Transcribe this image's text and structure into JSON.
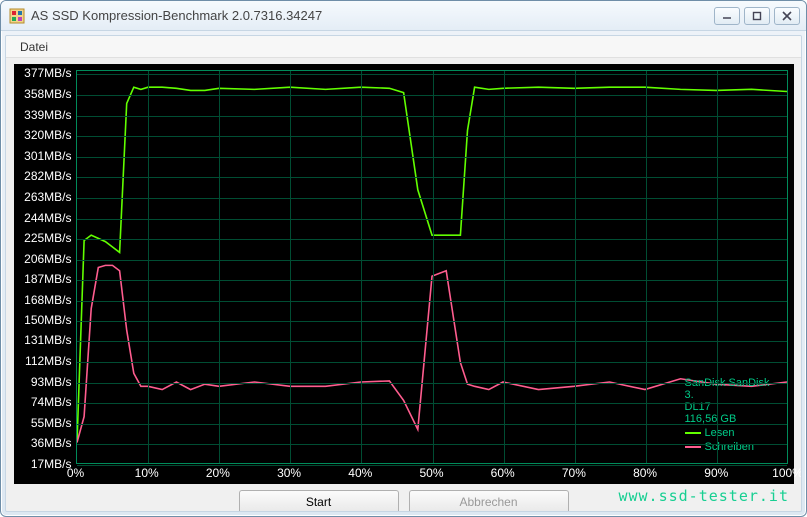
{
  "window": {
    "title": "AS SSD Kompression-Benchmark 2.0.7316.34247"
  },
  "menu": {
    "file": "Datei"
  },
  "buttons": {
    "start": "Start",
    "cancel": "Abbrechen"
  },
  "watermark": "www.ssd-tester.it",
  "legend": {
    "device_line1": "SanDisk SanDisk 3.",
    "device_line2": "DL17",
    "capacity": "116,56 GB",
    "read": "Lesen",
    "write": "Schreiben"
  },
  "colors": {
    "read_line": "#62ff00",
    "write_line": "#ff5d8f",
    "grid": "#004d33",
    "border": "#008b5a"
  },
  "chart_data": {
    "type": "line",
    "title": "AS SSD Kompression-Benchmark",
    "xlabel": "",
    "ylabel": "MB/s",
    "xlim": [
      0,
      100
    ],
    "ylim": [
      17,
      380
    ],
    "x_ticks": [
      "0%",
      "10%",
      "20%",
      "30%",
      "40%",
      "50%",
      "60%",
      "70%",
      "80%",
      "90%",
      "100%"
    ],
    "y_ticks": [
      "377MB/s",
      "358MB/s",
      "339MB/s",
      "320MB/s",
      "301MB/s",
      "282MB/s",
      "263MB/s",
      "244MB/s",
      "225MB/s",
      "206MB/s",
      "187MB/s",
      "168MB/s",
      "150MB/s",
      "131MB/s",
      "112MB/s",
      "93MB/s",
      "74MB/s",
      "55MB/s",
      "36MB/s",
      "17MB/s"
    ],
    "x": [
      0,
      1,
      2,
      3,
      4,
      5,
      6,
      7,
      8,
      9,
      10,
      12,
      14,
      16,
      18,
      20,
      25,
      30,
      35,
      40,
      44,
      46,
      48,
      50,
      52,
      54,
      55,
      56,
      58,
      60,
      65,
      70,
      75,
      80,
      85,
      90,
      95,
      100
    ],
    "series": [
      {
        "name": "Lesen",
        "color": "#62ff00",
        "values": [
          36,
          223,
          228,
          225,
          222,
          217,
          212,
          350,
          365,
          363,
          365,
          365,
          364,
          362,
          362,
          364,
          363,
          365,
          363,
          365,
          364,
          360,
          270,
          228,
          228,
          228,
          325,
          365,
          363,
          364,
          365,
          364,
          365,
          365,
          363,
          362,
          363,
          361
        ]
      },
      {
        "name": "Schreiben",
        "color": "#ff5d8f",
        "values": [
          36,
          60,
          160,
          198,
          200,
          200,
          195,
          140,
          100,
          88,
          88,
          85,
          92,
          85,
          90,
          88,
          92,
          88,
          88,
          92,
          93,
          75,
          48,
          190,
          195,
          110,
          90,
          88,
          85,
          92,
          85,
          88,
          92,
          85,
          95,
          90,
          88,
          92
        ]
      }
    ]
  }
}
